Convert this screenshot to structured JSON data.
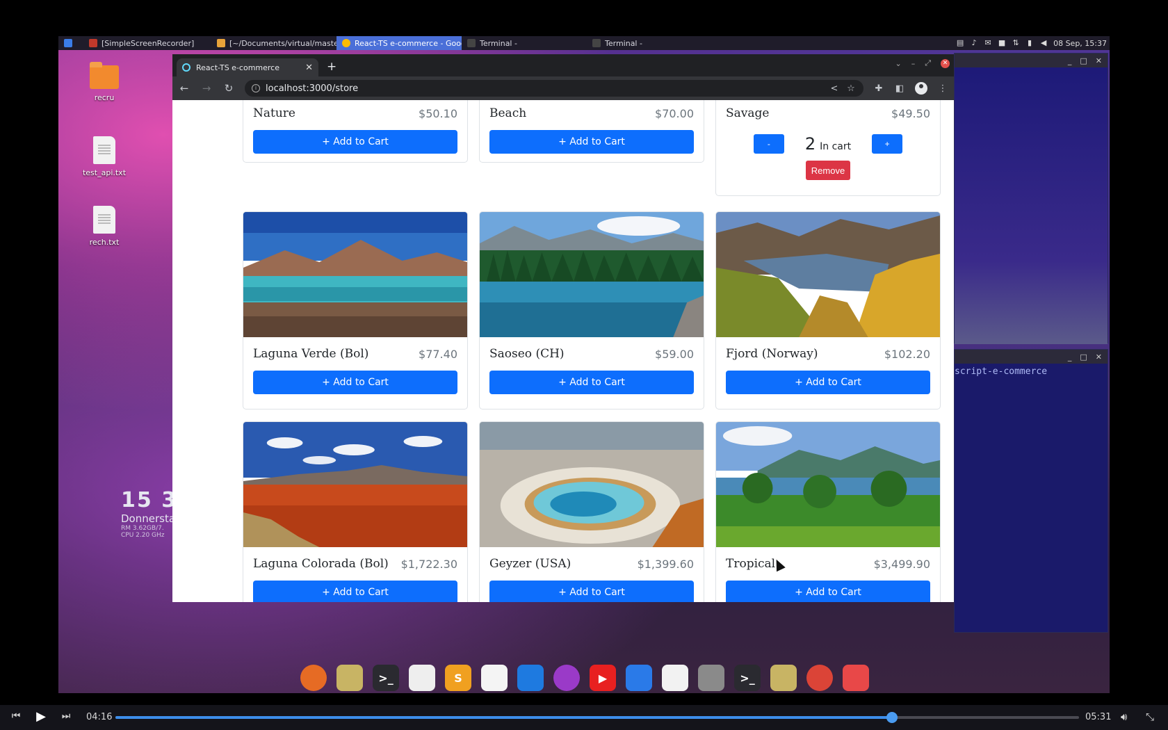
{
  "taskbar": {
    "tasks": [
      {
        "label": "[SimpleScreenRecorder]"
      },
      {
        "label": "[~/Documents/virtual/master..."
      },
      {
        "label": "React-TS e-commerce - Goog..."
      },
      {
        "label": "Terminal -"
      },
      {
        "label": "Terminal -"
      }
    ],
    "datetime": "08 Sep, 15:37"
  },
  "desktop": {
    "icons": [
      {
        "label": "recru",
        "icon": "folder-icon"
      },
      {
        "label": "test_api.txt",
        "icon": "text-file-icon"
      },
      {
        "label": "rech.txt",
        "icon": "text-file-icon"
      }
    ],
    "widget": {
      "time": "15 3",
      "day": "Donnersta",
      "ram": "RM 3.62GB/7.",
      "cpu": "CPU 2.20 GHz"
    }
  },
  "terminal2": {
    "text": "script-e-commerce"
  },
  "browser": {
    "tab_title": "React-TS e-commerce",
    "url": "localhost:3000/store",
    "new_tab": "+",
    "tab_close": "✕"
  },
  "store": {
    "add_label": "+ Add to Cart",
    "remove_label": "Remove",
    "minus_label": "-",
    "plus_label": "+",
    "in_cart_label": "In cart",
    "items": [
      {
        "name": "Nature",
        "price": "$50.10"
      },
      {
        "name": "Beach",
        "price": "$70.00"
      },
      {
        "name": "Savage",
        "price": "$49.50",
        "quantity": "2"
      },
      {
        "name": "Laguna Verde (Bol)",
        "price": "$77.40"
      },
      {
        "name": "Saoseo (CH)",
        "price": "$59.00"
      },
      {
        "name": "Fjord (Norway)",
        "price": "$102.20"
      },
      {
        "name": "Laguna Colorada (Bol)",
        "price": "$1,722.30"
      },
      {
        "name": "Geyzer (USA)",
        "price": "$1,399.60"
      },
      {
        "name": "Tropical",
        "price": "$3,499.90"
      }
    ]
  },
  "player": {
    "current_time": "04:16",
    "total_time": "05:31",
    "progress": 0.806
  },
  "colors": {
    "primary": "#0d6efd",
    "danger": "#dc3545",
    "seek": "#3d8eea"
  }
}
